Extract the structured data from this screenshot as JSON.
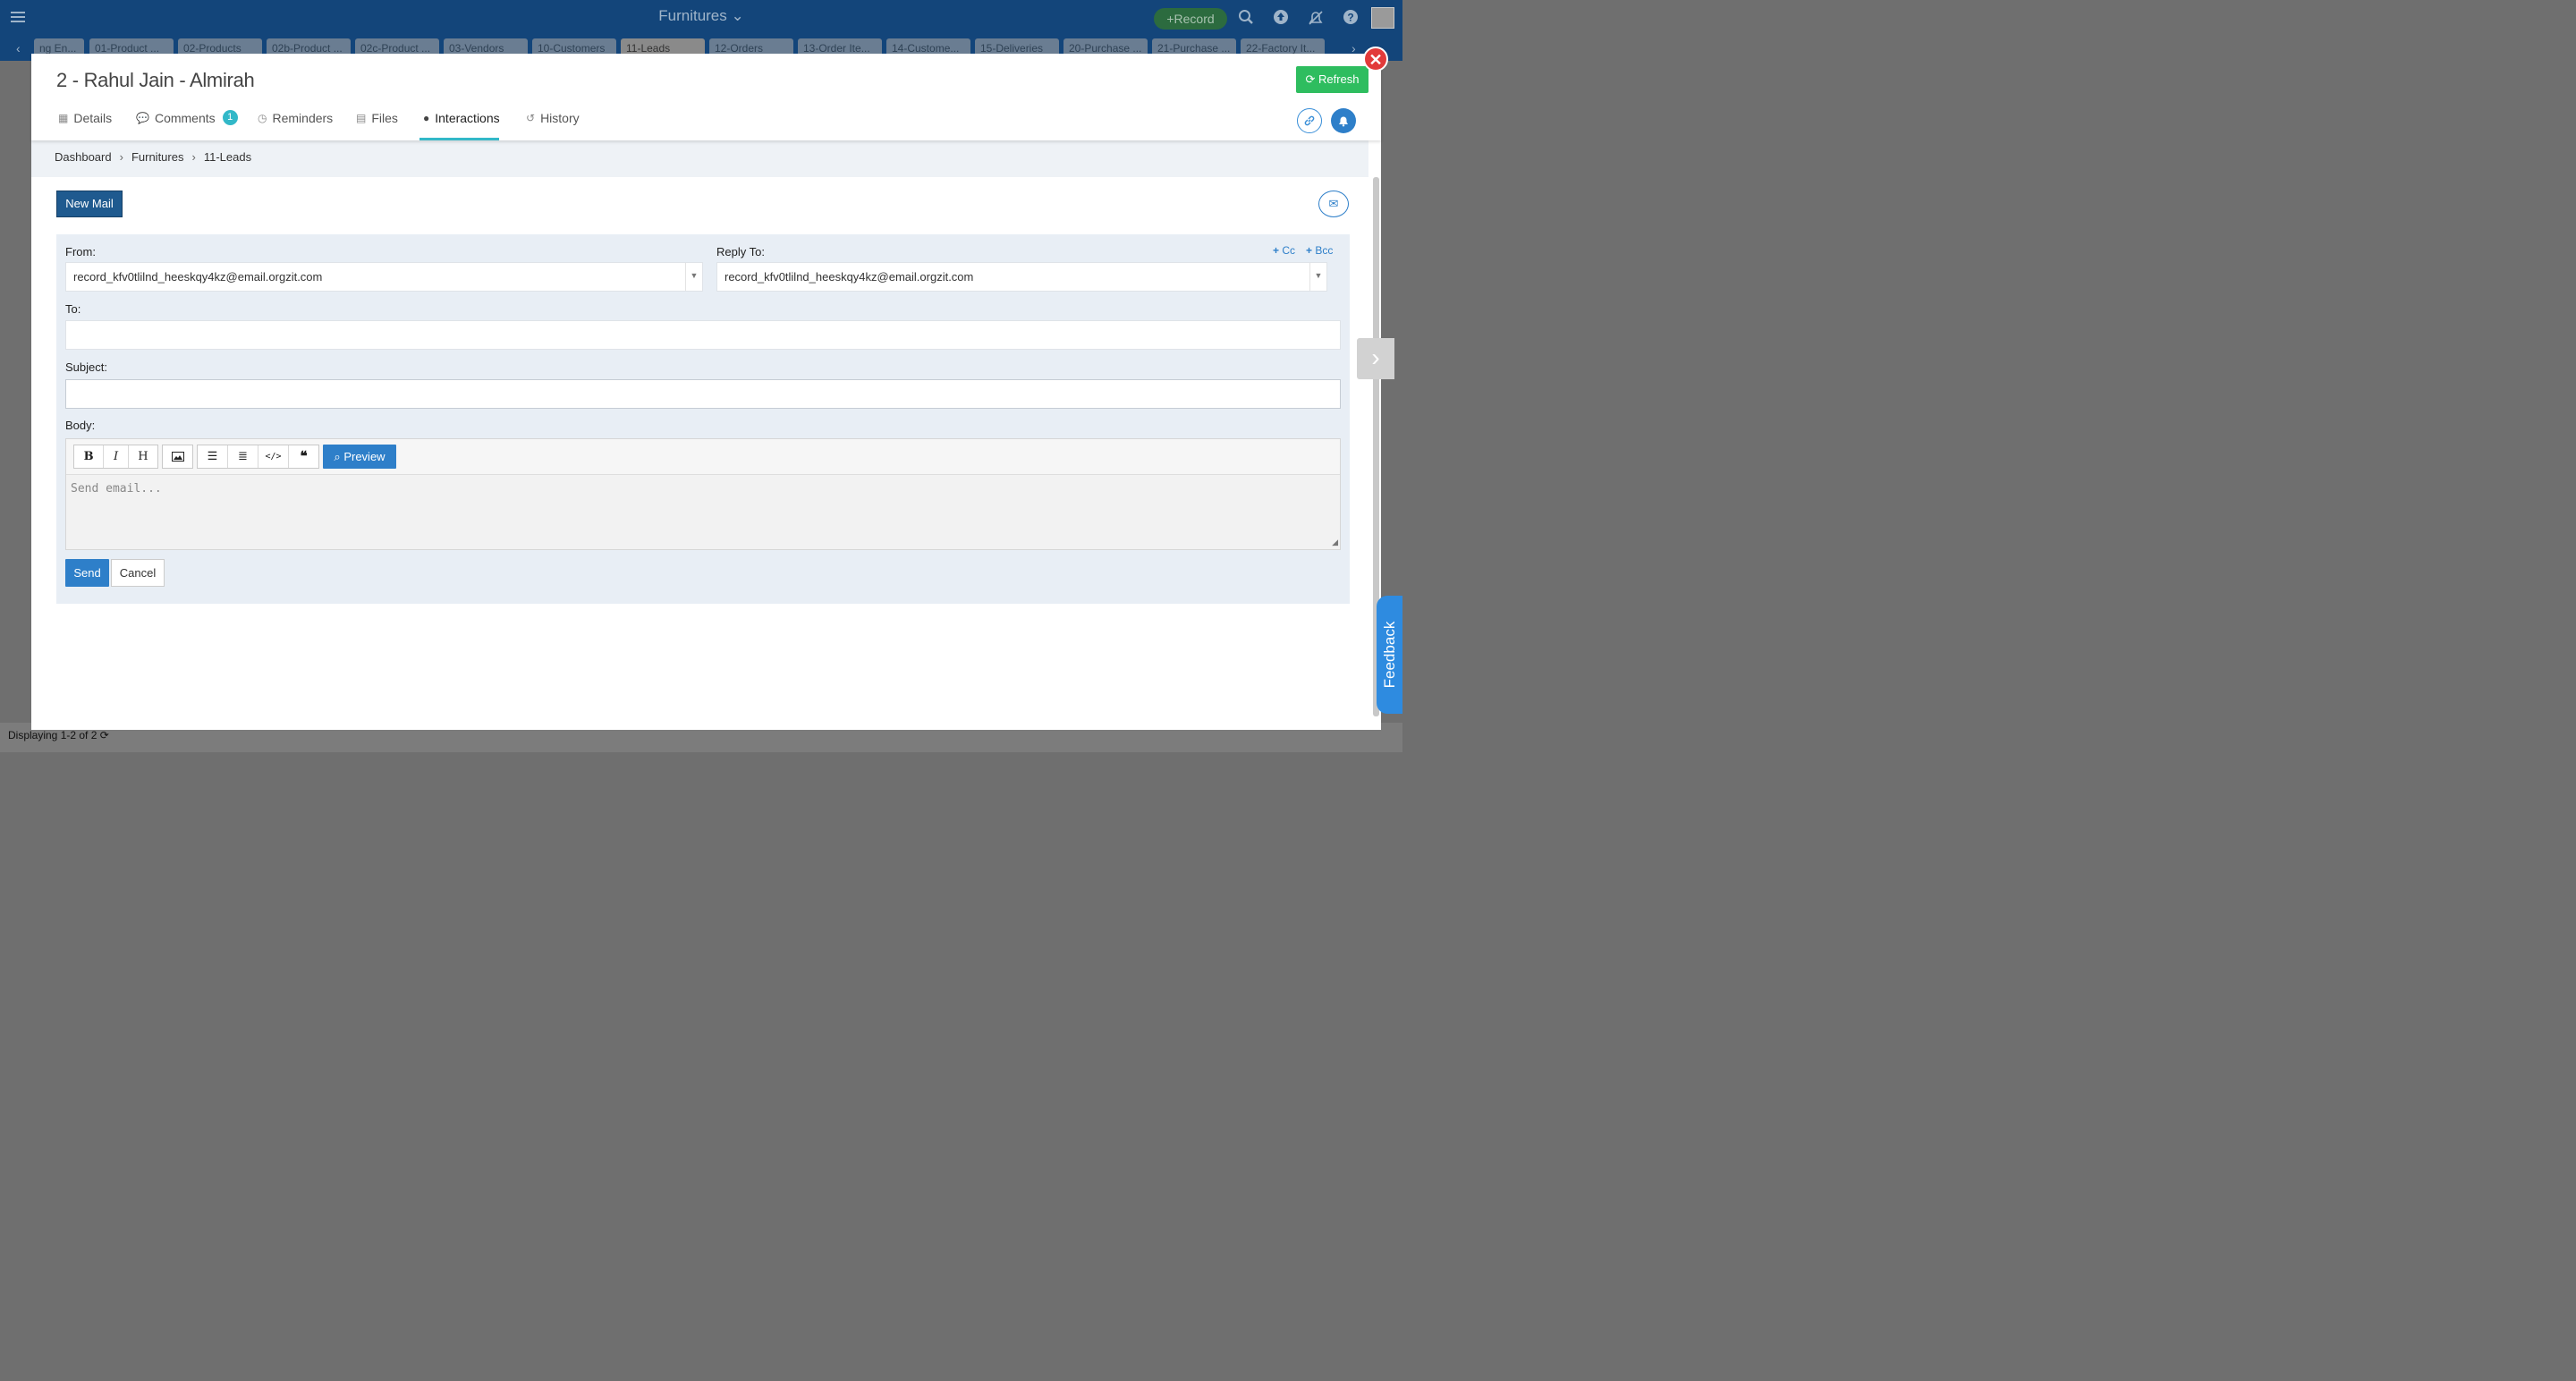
{
  "app": {
    "title": "Furnitures",
    "record_label": "Record",
    "tabs": [
      "ng En...",
      "01-Product ...",
      "02-Products",
      "02b-Product ...",
      "02c-Product ...",
      "03-Vendors",
      "10-Customers",
      "11-Leads",
      "12-Orders",
      "13-Order Ite...",
      "14-Custome...",
      "15-Deliveries",
      "20-Purchase ...",
      "21-Purchase ...",
      "22-Factory It..."
    ],
    "active_tab": "11-Leads",
    "footer_text": "Displaying 1-2 of 2",
    "icons": [
      "menu-icon",
      "search-icon",
      "upload-icon",
      "notifications-off-icon",
      "help-icon",
      "monitor-icon"
    ]
  },
  "modal": {
    "title": "2 - Rahul Jain - Almirah",
    "refresh_label": "Refresh",
    "close_symbol": "✕",
    "tabs": [
      {
        "label": "Details",
        "icon": "table-icon"
      },
      {
        "label": "Comments",
        "icon": "comments-icon",
        "badge": "1"
      },
      {
        "label": "Reminders",
        "icon": "clock-icon"
      },
      {
        "label": "Files",
        "icon": "file-icon"
      },
      {
        "label": "Interactions",
        "icon": "user-icon",
        "active": true
      },
      {
        "label": "History",
        "icon": "history-icon"
      }
    ],
    "breadcrumb": [
      "Dashboard",
      "Furnitures",
      "11-Leads"
    ],
    "breadcrumb_sep": "›"
  },
  "compose": {
    "new_mail_label": "New Mail",
    "from_label": "From:",
    "from_value": "record_kfv0tlilnd_heeskqy4kz@email.orgzit.com",
    "reply_to_label": "Reply To:",
    "reply_to_value": "record_kfv0tlilnd_heeskqy4kz@email.orgzit.com",
    "cc_label": "Cc",
    "bcc_label": "Bcc",
    "to_label": "To:",
    "to_value": "",
    "subject_label": "Subject:",
    "subject_value": "",
    "body_label": "Body:",
    "body_placeholder": "Send email...",
    "toolbar": [
      "B",
      "I",
      "H"
    ],
    "preview_label": "Preview",
    "send_label": "Send",
    "cancel_label": "Cancel"
  },
  "feedback_label": "Feedback",
  "colors": {
    "topbar": "#13457a",
    "accent": "#2e7fc9",
    "active_tab_underline": "#32b8c8",
    "refresh_button": "#2ebd5f",
    "close_button": "#e23a3a"
  }
}
